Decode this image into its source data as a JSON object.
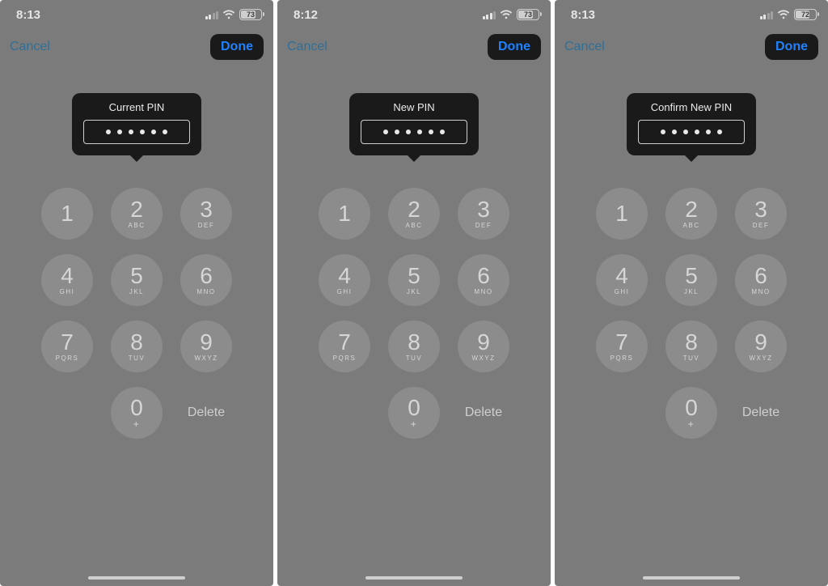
{
  "screens": [
    {
      "status": {
        "time": "8:13",
        "signal_strength": 2,
        "battery_pct": 73
      },
      "nav": {
        "cancel": "Cancel",
        "done": "Done"
      },
      "pin": {
        "title": "Current PIN",
        "dots": 6
      },
      "delete_label": "Delete"
    },
    {
      "status": {
        "time": "8:12",
        "signal_strength": 3,
        "battery_pct": 73
      },
      "nav": {
        "cancel": "Cancel",
        "done": "Done"
      },
      "pin": {
        "title": "New PIN",
        "dots": 6
      },
      "delete_label": "Delete"
    },
    {
      "status": {
        "time": "8:13",
        "signal_strength": 2,
        "battery_pct": 72
      },
      "nav": {
        "cancel": "Cancel",
        "done": "Done"
      },
      "pin": {
        "title": "Confirm New PIN",
        "dots": 6
      },
      "delete_label": "Delete"
    }
  ],
  "keypad": [
    {
      "digit": "1",
      "letters": ""
    },
    {
      "digit": "2",
      "letters": "ABC"
    },
    {
      "digit": "3",
      "letters": "DEF"
    },
    {
      "digit": "4",
      "letters": "GHI"
    },
    {
      "digit": "5",
      "letters": "JKL"
    },
    {
      "digit": "6",
      "letters": "MNO"
    },
    {
      "digit": "7",
      "letters": "PQRS"
    },
    {
      "digit": "8",
      "letters": "TUV"
    },
    {
      "digit": "9",
      "letters": "WXYZ"
    },
    {
      "digit": "0",
      "letters": "+"
    }
  ]
}
